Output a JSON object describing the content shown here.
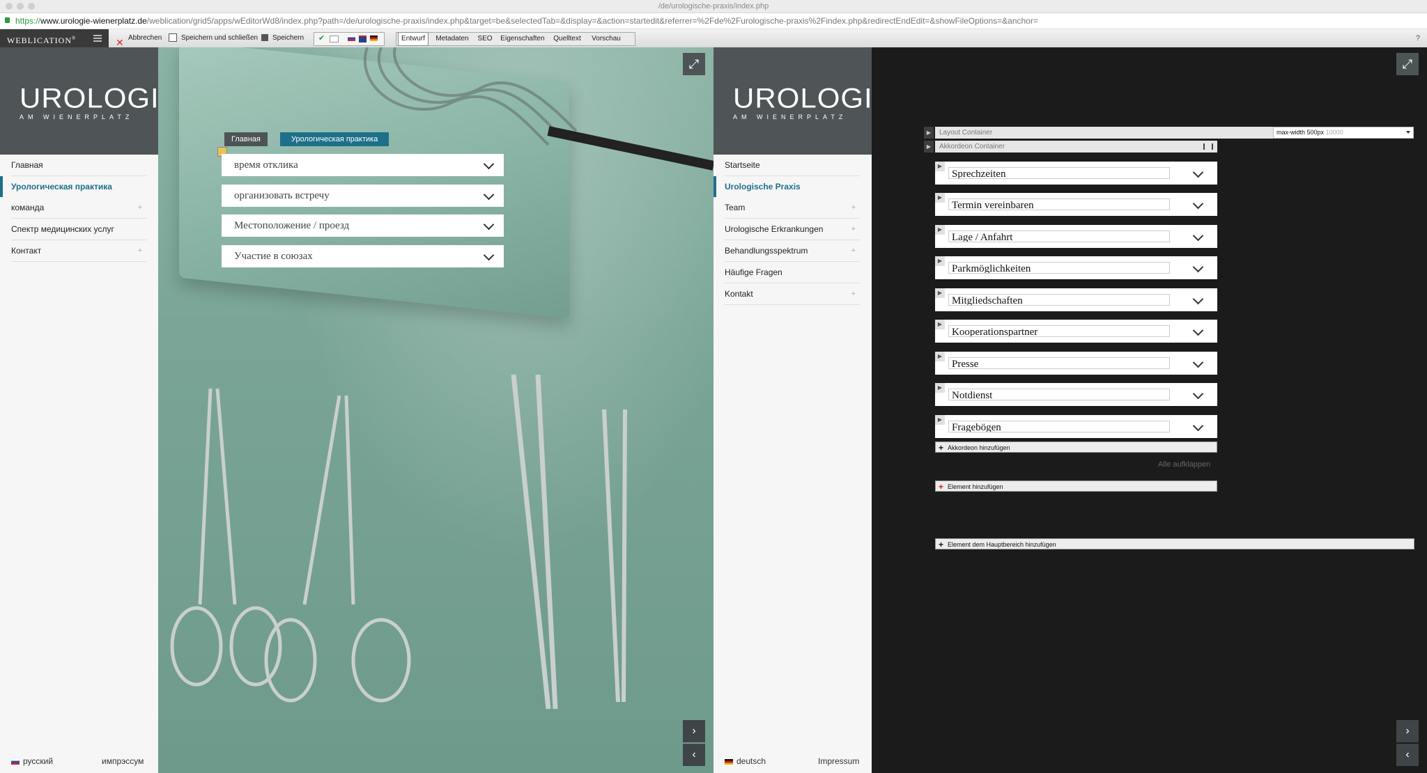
{
  "browser": {
    "title": "/de/urologische-praxis/index.php",
    "url_scheme": "https://",
    "url_host": "www.urologie-wienerplatz.de",
    "url_rest": "/weblication/grid5/apps/wEditorWd8/index.php?path=/de/urologische-praxis/index.php&target=be&selectedTab=&display=&action=startedit&referrer=%2Fde%2Furologische-praxis%2Findex.php&redirectEndEdit=&showFileOptions=&anchor="
  },
  "cms_toolbar": {
    "brand": "WEBLICATION",
    "trademark": "®",
    "cancel": "Abbrechen",
    "save_close": "Speichern und schließen",
    "save": "Speichern",
    "tabs": [
      "Entwurf",
      "Metadaten",
      "SEO",
      "Eigenschaften",
      "Quelltext",
      "Vorschau"
    ],
    "active_tab": "Entwurf",
    "help": "?"
  },
  "logo": {
    "main": "UROLOGIE",
    "sub": "AM WIENERPLATZ"
  },
  "ru_site": {
    "nav": [
      {
        "label": "Главная",
        "plus": ""
      },
      {
        "label": "Урологическая практика",
        "plus": ""
      },
      {
        "label": "команда",
        "plus": "+"
      },
      {
        "label": "Спектр медицинских услуг",
        "plus": ""
      },
      {
        "label": "Контакт",
        "plus": "+"
      }
    ],
    "breadcrumb": [
      "Главная",
      "Урологическая практика"
    ],
    "accordions": [
      "время отклика",
      "организовать встречу",
      "Местоположение / проезд",
      "Участие в союзах"
    ],
    "footer_lang": "русский",
    "footer_imprint": "импрэссум"
  },
  "de_site": {
    "nav": [
      {
        "label": "Startseite",
        "plus": ""
      },
      {
        "label": "Urologische Praxis",
        "plus": ""
      },
      {
        "label": "Team",
        "plus": "+"
      },
      {
        "label": "Urologische Erkrankungen",
        "plus": "+"
      },
      {
        "label": "Behandlungsspektrum",
        "plus": "+"
      },
      {
        "label": "Häufige Fragen",
        "plus": ""
      },
      {
        "label": "Kontakt",
        "plus": "+"
      }
    ],
    "footer_lang": "deutsch",
    "footer_imprint": "Impressum"
  },
  "editor": {
    "layout_container": "Layout Container",
    "max_width_label": "max-width 500px",
    "max_width_grey": "10000",
    "accordion_container": "Akkordeon Container",
    "accordions": [
      "Sprechzeiten",
      "Termin vereinbaren",
      "Lage / Anfahrt",
      "Parkmöglichkeiten",
      "Mitgliedschaften",
      "Kooperationspartner",
      "Presse",
      "Notdienst",
      "Fragebögen"
    ],
    "add_accordion": "Akkordeon hinzufügen",
    "expand_all": "Alle aufklappen",
    "add_element": "Element hinzufügen",
    "add_main_element": "Element dem Hauptbereich hinzufügen"
  },
  "icons": {
    "expand": "⤢",
    "next": "›",
    "prev": "‹"
  },
  "colors": {
    "accent": "#1e6f8a",
    "header": "#4f5557",
    "editor_bg": "#1b1b1b"
  }
}
